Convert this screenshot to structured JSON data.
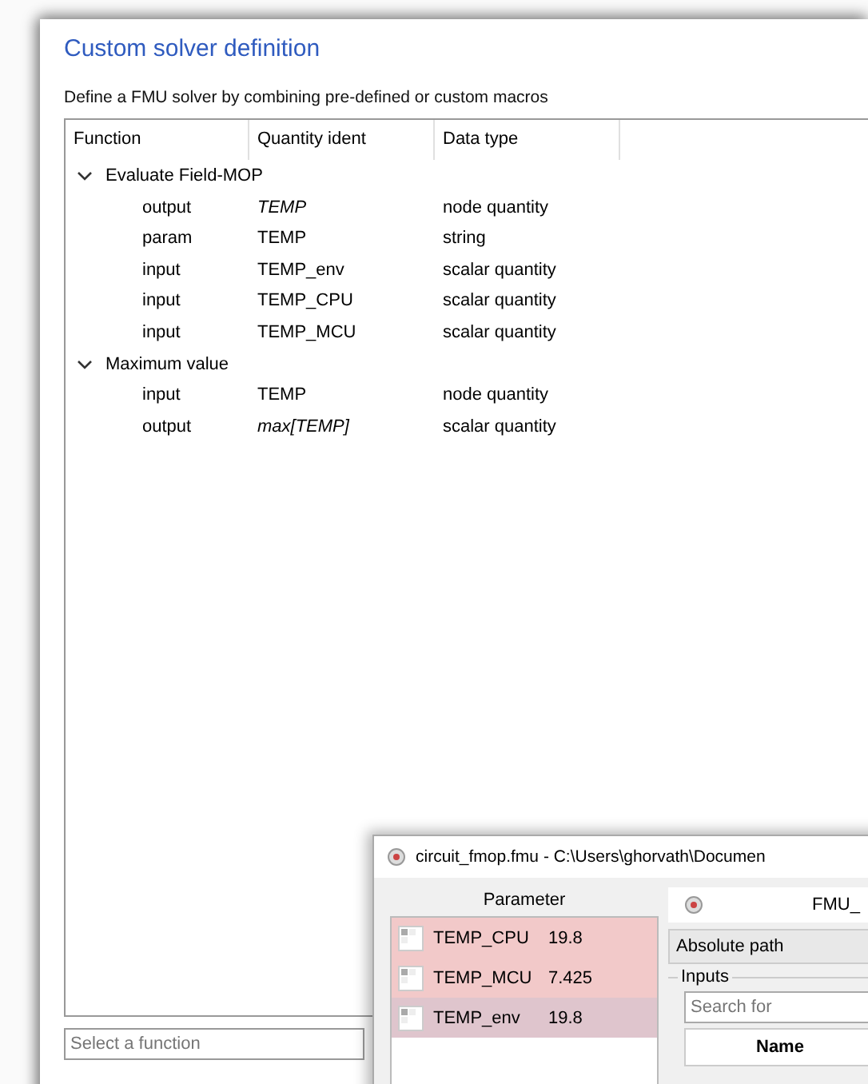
{
  "dialog": {
    "title": "Custom solver definition",
    "description": "Define a FMU solver by combining pre-defined or custom macros"
  },
  "tree": {
    "columns": [
      "Function",
      "Quantity ident",
      "Data type"
    ],
    "groups": [
      {
        "label": "Evaluate Field-MOP",
        "expanded": true,
        "children": [
          {
            "function": "output",
            "ident": "TEMP",
            "italic": true,
            "type": "node quantity"
          },
          {
            "function": "param",
            "ident": "TEMP",
            "italic": false,
            "type": "string"
          },
          {
            "function": "input",
            "ident": "TEMP_env",
            "italic": false,
            "type": "scalar quantity"
          },
          {
            "function": "input",
            "ident": "TEMP_CPU",
            "italic": false,
            "type": "scalar quantity"
          },
          {
            "function": "input",
            "ident": "TEMP_MCU",
            "italic": false,
            "type": "scalar quantity"
          }
        ]
      },
      {
        "label": "Maximum value",
        "expanded": true,
        "children": [
          {
            "function": "input",
            "ident": "TEMP",
            "italic": false,
            "type": "node quantity"
          },
          {
            "function": "output",
            "ident": "max[TEMP]",
            "italic": true,
            "type": "scalar quantity"
          }
        ]
      }
    ]
  },
  "function_field": {
    "placeholder": "Select a function"
  },
  "fmu_window": {
    "title": "circuit_fmop.fmu - C:\\Users\\ghorvath\\Documen",
    "parameter_header": "Parameter",
    "parameters": [
      {
        "name": "TEMP_CPU",
        "value": "19.8",
        "color": "#f2c9c9"
      },
      {
        "name": "TEMP_MCU",
        "value": "7.425",
        "color": "#f2c9c9"
      },
      {
        "name": "TEMP_env",
        "value": "19.8",
        "color": "#dfc5cd"
      }
    ],
    "fmu_label": "FMU_",
    "path_mode": "Absolute path",
    "inputs_label": "Inputs",
    "search": {
      "placeholder": "Search for"
    },
    "table_header": "Name"
  }
}
